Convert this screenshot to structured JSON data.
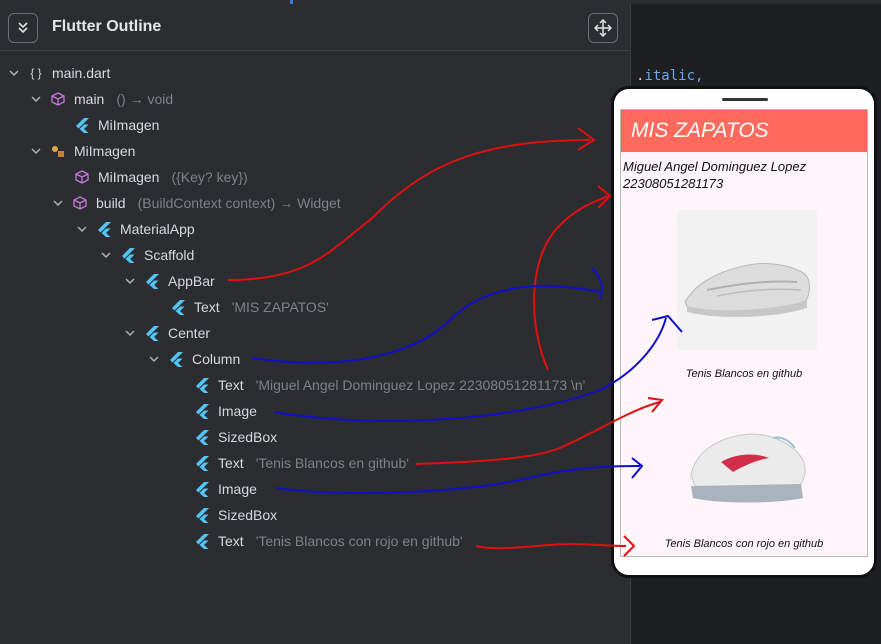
{
  "panel": {
    "title": "Flutter Outline",
    "collapse_icon": "double-chevron-down-icon",
    "move_icon": "move-arrows-icon"
  },
  "code_fragment": {
    "dot": ".",
    "text": "italic,"
  },
  "tree": [
    {
      "label": "main.dart",
      "detail": "",
      "icon": "braces-icon"
    },
    {
      "label": "main",
      "detail": "() → void",
      "icon": "function-cube-icon"
    },
    {
      "label": "MiImagen",
      "detail": "",
      "icon": "flutter-icon"
    },
    {
      "label": "MiImagen",
      "detail": "",
      "icon": "class-icon"
    },
    {
      "label": "MiImagen",
      "detail": "({Key? key})",
      "icon": "constructor-cube-icon"
    },
    {
      "label": "build",
      "detail": "(BuildContext context) → Widget",
      "icon": "method-cube-icon"
    },
    {
      "label": "MaterialApp",
      "detail": "",
      "icon": "flutter-icon"
    },
    {
      "label": "Scaffold",
      "detail": "",
      "icon": "flutter-icon"
    },
    {
      "label": "AppBar",
      "detail": "",
      "icon": "flutter-icon"
    },
    {
      "label": "Text",
      "detail": "'MIS ZAPATOS'",
      "icon": "flutter-icon"
    },
    {
      "label": "Center",
      "detail": "",
      "icon": "flutter-icon"
    },
    {
      "label": "Column",
      "detail": "",
      "icon": "flutter-icon"
    },
    {
      "label": "Text",
      "detail": "'Miguel Angel Dominguez Lopez 22308051281173 \\n'",
      "icon": "flutter-icon"
    },
    {
      "label": "Image",
      "detail": "",
      "icon": "flutter-icon"
    },
    {
      "label": "SizedBox",
      "detail": "",
      "icon": "flutter-icon"
    },
    {
      "label": "Text",
      "detail": "'Tenis Blancos en github'",
      "icon": "flutter-icon"
    },
    {
      "label": "Image",
      "detail": "",
      "icon": "flutter-icon"
    },
    {
      "label": "SizedBox",
      "detail": "",
      "icon": "flutter-icon"
    },
    {
      "label": "Text",
      "detail": "'Tenis Blancos con rojo en github'",
      "icon": "flutter-icon"
    }
  ],
  "app_preview": {
    "appbar_title": "MIS ZAPATOS",
    "author_text": "Miguel Angel Dominguez Lopez\n22308051281173",
    "image1_caption": "Tenis Blancos en github",
    "image2_caption": "Tenis Blancos con rojo en github",
    "appbar_color": "#ff6a5c"
  },
  "colors": {
    "panel_bg": "#2b2d30",
    "flutter_icon": "#54c5f8",
    "annotation_red": "#e01010",
    "annotation_blue": "#1010c8"
  }
}
